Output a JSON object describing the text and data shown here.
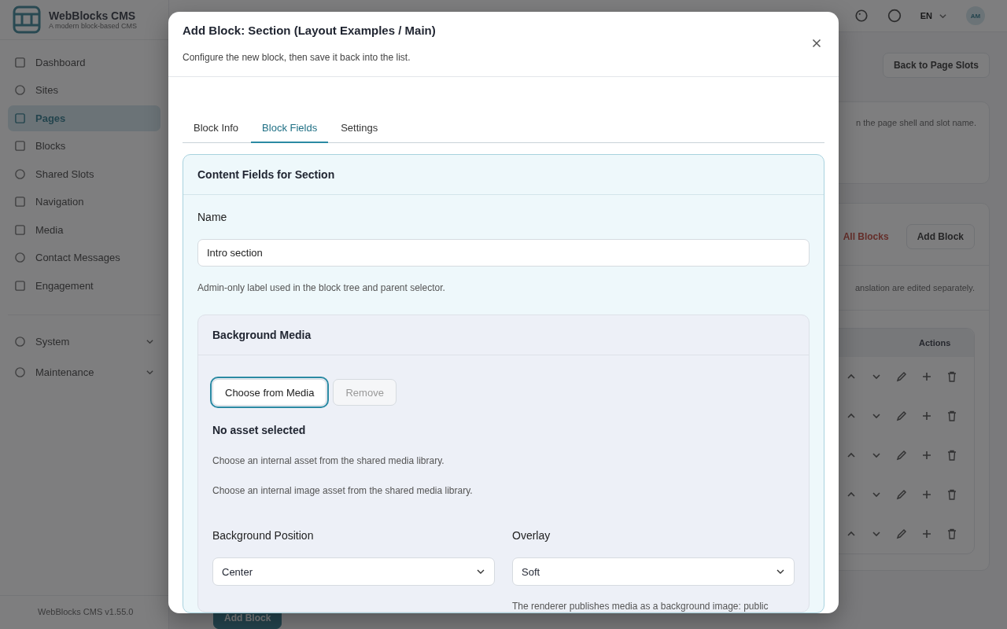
{
  "app": {
    "brand": "WebBlocks CMS",
    "tagline": "A modern block-based CMS",
    "version": "WebBlocks CMS v1.55.0"
  },
  "sidebar": {
    "items": [
      {
        "label": "Dashboard",
        "selected": false
      },
      {
        "label": "Sites",
        "selected": false
      },
      {
        "label": "Pages",
        "selected": true
      },
      {
        "label": "Blocks",
        "selected": false
      },
      {
        "label": "Shared Slots",
        "selected": false
      },
      {
        "label": "Navigation",
        "selected": false
      },
      {
        "label": "Media",
        "selected": false
      },
      {
        "label": "Contact Messages",
        "selected": false
      },
      {
        "label": "Engagement",
        "selected": false
      }
    ],
    "groups": [
      {
        "label": "System",
        "expanded": false
      },
      {
        "label": "Maintenance",
        "expanded": false
      }
    ]
  },
  "header": {
    "language": "EN",
    "avatar": "AM"
  },
  "page": {
    "back_button": "Back to Page Slots",
    "info_text": "n the page shell and slot name.",
    "clear_link": "All Blocks",
    "add_button": "Add Block",
    "note": "anslation are edited separately.",
    "table": {
      "columns": [
        "Actions"
      ],
      "rows": [
        {
          "kind": "block"
        },
        {
          "kind": "block"
        },
        {
          "kind": "block"
        },
        {
          "kind": "block"
        },
        {
          "kind": "block"
        }
      ]
    },
    "bottom_button": "Add Block"
  },
  "modal": {
    "title": "Add Block: Section (Layout Examples / Main)",
    "subtitle": "Configure the new block, then save it back into the list.",
    "tabs": [
      {
        "label": "Block Info",
        "selected": false
      },
      {
        "label": "Block Fields",
        "selected": true
      },
      {
        "label": "Settings",
        "selected": false
      }
    ],
    "section": {
      "title": "Content Fields for Section",
      "name_field": {
        "label": "Name",
        "value": "Intro section",
        "help": "Admin-only label used in the block tree and parent selector."
      },
      "media": {
        "title": "Background Media",
        "choose_button": "Choose from Media",
        "remove_button": {
          "label": "Remove",
          "disabled": true
        },
        "status": "No asset selected",
        "help": [
          "Choose an internal asset from the shared media library.",
          "Choose an internal image asset from the shared media library."
        ],
        "position": {
          "label": "Background Position",
          "value": "Center"
        },
        "overlay": {
          "label": "Overlay",
          "value": "Soft"
        },
        "note": "The renderer publishes media as a background image: public"
      }
    }
  }
}
